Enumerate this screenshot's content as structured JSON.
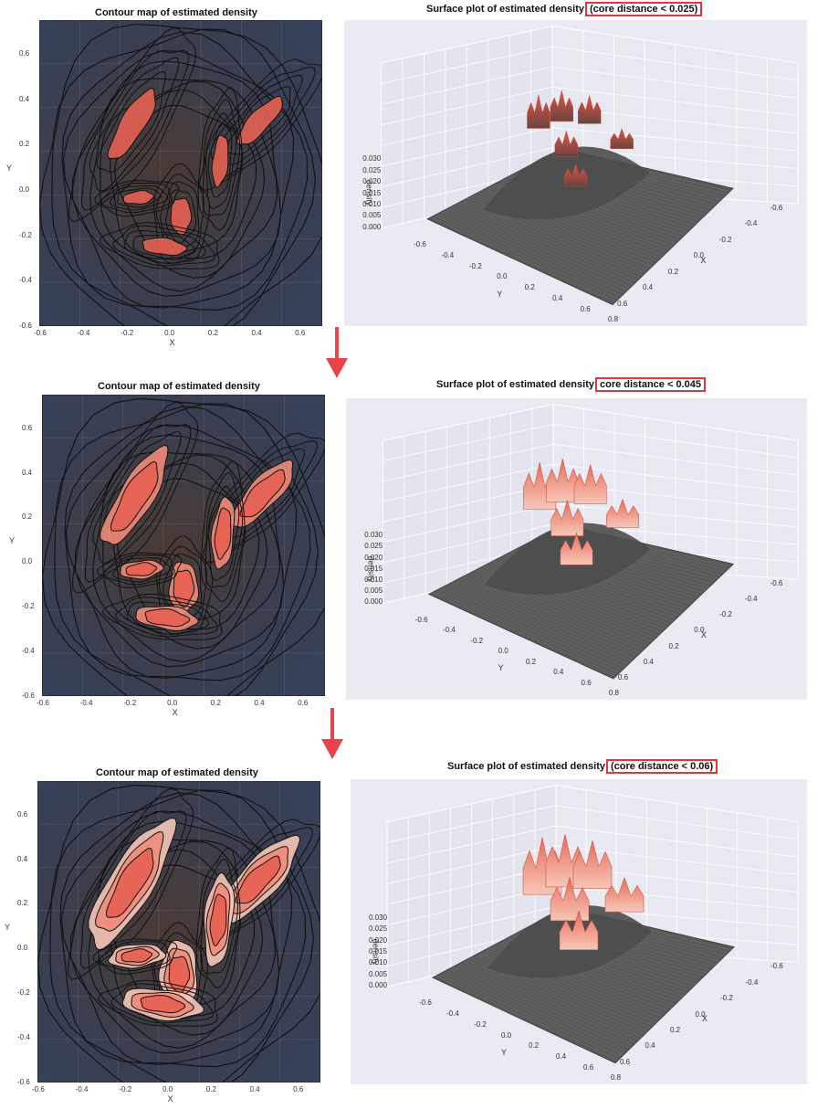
{
  "colors": {
    "contour_bg": "#3b4459",
    "surface_bg": "#eaeaf2",
    "surface_gray": "#5a5a5a",
    "peak_red": "#e05545",
    "peak_light": "#f6c7b8",
    "highlight_box": "#e0373f",
    "arrow": "#e8434a"
  },
  "rows": [
    {
      "contour_title": "Contour map of estimated density",
      "surface_title": "Surface plot of estimated density",
      "surface_tag": "(core distance < 0.025)",
      "core_distance": 0.025
    },
    {
      "contour_title": "Contour map of estimated density",
      "surface_title": "Surface plot of estimated density",
      "surface_tag": "core distance < 0.045",
      "core_distance": 0.045
    },
    {
      "contour_title": "Contour map of estimated density",
      "surface_title": "Surface plot of estimated density",
      "surface_tag": "(core distance < 0.06)",
      "core_distance": 0.06
    }
  ],
  "contour_axes": {
    "xlabel": "X",
    "ylabel": "Y",
    "xticks": [
      "-0.6",
      "-0.4",
      "-0.2",
      "0.0",
      "0.2",
      "0.4",
      "0.6"
    ],
    "yticks": [
      "0.6",
      "0.4",
      "0.2",
      "0.0",
      "-0.2",
      "-0.4",
      "-0.6"
    ]
  },
  "surface_axes": {
    "zlabel": "density",
    "zticks": [
      "0.030",
      "0.025",
      "0.020",
      "0.015",
      "0.010",
      "0.005",
      "0.000"
    ],
    "yticks": [
      "-0.6",
      "-0.4",
      "-0.2",
      "0.0",
      "0.2",
      "0.4",
      "0.6",
      "0.8"
    ],
    "ylabel": "Y",
    "xticks": [
      "-0.6",
      "-0.4",
      "-0.2",
      "0.0",
      "0.2",
      "0.4",
      "0.6"
    ],
    "xlabel": "X"
  },
  "chart_data": [
    {
      "type": "heatmap",
      "title": "Contour map of estimated density",
      "xlabel": "X",
      "ylabel": "Y",
      "xlim": [
        -0.6,
        0.7
      ],
      "ylim": [
        -0.6,
        0.75
      ],
      "highlight_core_distance": 0.025
    },
    {
      "type": "heatmap",
      "title": "Surface plot of estimated density (core distance < 0.025)",
      "xlabel": "X",
      "ylabel": "Y",
      "zlabel": "density",
      "zlim": [
        0.0,
        0.03
      ]
    },
    {
      "type": "heatmap",
      "title": "Contour map of estimated density",
      "xlabel": "X",
      "ylabel": "Y",
      "xlim": [
        -0.6,
        0.7
      ],
      "ylim": [
        -0.6,
        0.75
      ],
      "highlight_core_distance": 0.045
    },
    {
      "type": "heatmap",
      "title": "Surface plot of estimated density core distance < 0.045",
      "xlabel": "X",
      "ylabel": "Y",
      "zlabel": "density",
      "zlim": [
        0.0,
        0.03
      ]
    },
    {
      "type": "heatmap",
      "title": "Contour map of estimated density",
      "xlabel": "X",
      "ylabel": "Y",
      "xlim": [
        -0.6,
        0.7
      ],
      "ylim": [
        -0.6,
        0.75
      ],
      "highlight_core_distance": 0.06
    },
    {
      "type": "heatmap",
      "title": "Surface plot of estimated density (core distance < 0.06)",
      "xlabel": "X",
      "ylabel": "Y",
      "zlabel": "density",
      "zlim": [
        0.0,
        0.03
      ]
    }
  ]
}
